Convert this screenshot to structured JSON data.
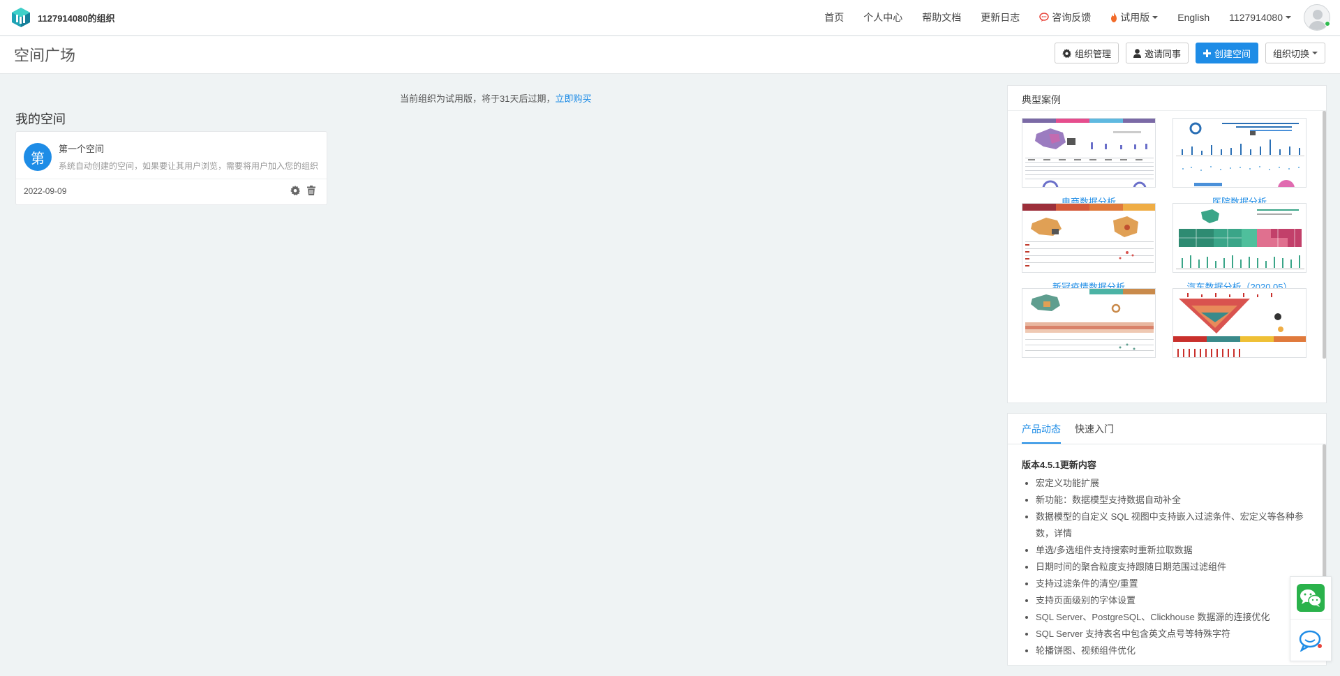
{
  "brand": {
    "org_name": "1127914080的组织"
  },
  "nav": {
    "home": "首页",
    "profile": "个人中心",
    "help": "帮助文档",
    "changelog": "更新日志",
    "feedback": "咨询反馈",
    "trial": "试用版",
    "language": "English",
    "user": "1127914080"
  },
  "header": {
    "title": "空间广场",
    "org_manage": "组织管理",
    "invite": "邀请同事",
    "create_space": "创建空间",
    "switch_org": "组织切换"
  },
  "trial_notice": {
    "text": "当前组织为试用版，将于31天后过期，",
    "buy": "立即购买"
  },
  "my_spaces": {
    "title": "我的空间",
    "spaces": [
      {
        "avatar_char": "第",
        "name": "第一个空间",
        "description": "系统自动创建的空间，如果要让其用户浏览，需要将用户加入您的组织",
        "date": "2022-09-09"
      }
    ]
  },
  "cases": {
    "title": "典型案例",
    "items": [
      {
        "label": "电商数据分析"
      },
      {
        "label": "医院数据分析"
      },
      {
        "label": "新冠疫情数据分析"
      },
      {
        "label": "汽车数据分析（2020.05）"
      },
      {
        "label": ""
      },
      {
        "label": ""
      }
    ]
  },
  "news": {
    "tabs": [
      "产品动态",
      "快速入门"
    ],
    "version_title": "版本4.5.1更新内容",
    "items": [
      "宏定义功能扩展",
      "新功能：数据模型支持数据自动补全",
      "数据模型的自定义 SQL 视图中支持嵌入过滤条件、宏定义等各种参数，详情",
      "单选/多选组件支持搜索时重新拉取数据",
      "日期时间的聚合粒度支持跟随日期范围过滤组件",
      "支持过滤条件的清空/重置",
      "支持页面级别的字体设置",
      "SQL Server、PostgreSQL、Clickhouse 数据源的连接优化",
      "SQL Server 支持表名中包含英文点号等特殊字符",
      "轮播饼图、视频组件优化"
    ]
  },
  "colors": {
    "primary": "#1e8ce6",
    "wechat": "#2ab24b",
    "background": "#eff3f4"
  }
}
